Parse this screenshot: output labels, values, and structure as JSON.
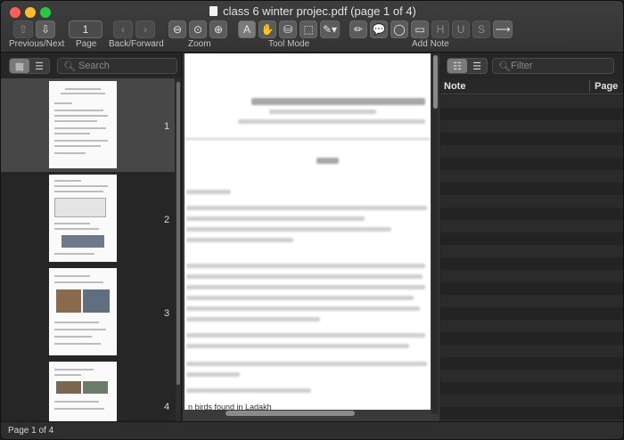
{
  "window": {
    "title": "class 6 winter projec.pdf (page 1 of 4)"
  },
  "toolbar": {
    "prev_next_label": "Previous/Next",
    "page_label": "Page",
    "page_value": "1",
    "back_forward_label": "Back/Forward",
    "zoom_label": "Zoom",
    "tool_mode_label": "Tool Mode",
    "add_note_label": "Add Note"
  },
  "sidebar": {
    "search_placeholder": "Search",
    "thumbnails": [
      {
        "page": "1"
      },
      {
        "page": "2"
      },
      {
        "page": "3"
      },
      {
        "page": "4"
      }
    ]
  },
  "document": {
    "visible_text": "n birds found in Ladakh"
  },
  "notes": {
    "filter_placeholder": "Filter",
    "col_note": "Note",
    "col_page": "Page"
  },
  "status": {
    "text": "Page 1 of 4"
  }
}
